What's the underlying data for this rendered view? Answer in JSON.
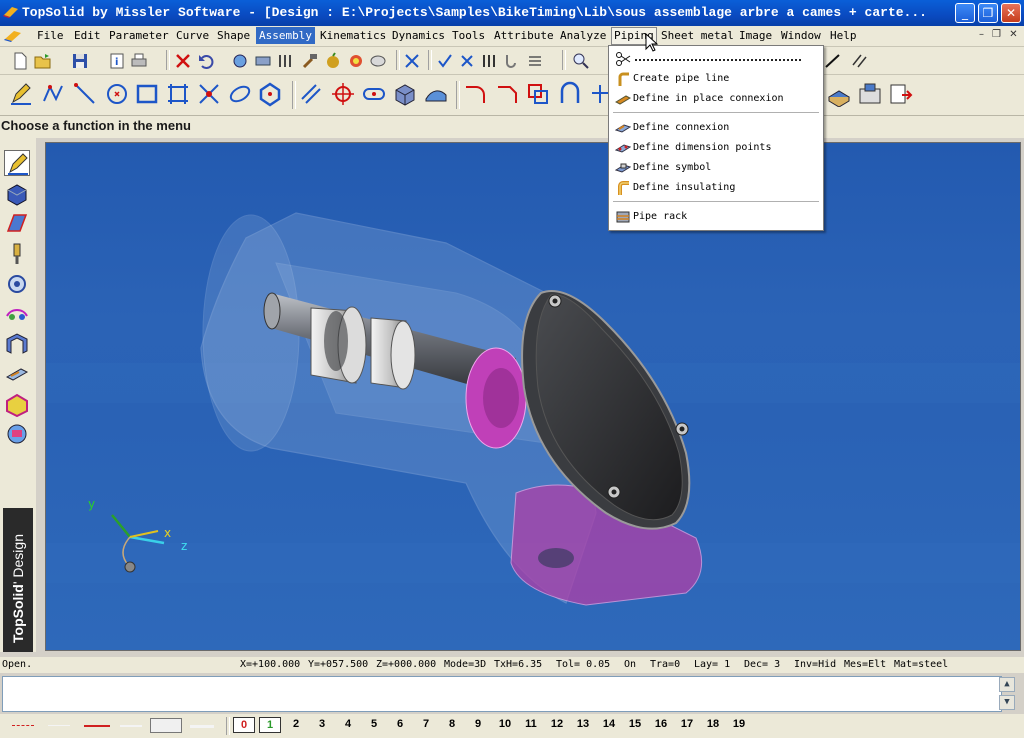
{
  "window": {
    "title": "TopSolid by Missler Software - [Design : E:\\Projects\\Samples\\BikeTiming\\Lib\\sous assemblage arbre a cames + carte...",
    "minimize": "_",
    "maximize": "❒",
    "close": "✕"
  },
  "menu": {
    "items": [
      "File",
      "Edit",
      "Parameter",
      "Curve",
      "Shape",
      "Assembly",
      "Kinematics",
      "Dynamics",
      "Tools",
      "Attribute",
      "Analyze",
      "Piping",
      "Sheet metal",
      "Image",
      "Window",
      "Help"
    ],
    "active": "Assembly",
    "open": "Piping"
  },
  "prompt": "Choose a function in the menu",
  "brand": {
    "strong": "TopSolid",
    "light": "' Design"
  },
  "piping_menu": {
    "items": [
      {
        "label": "Create pipe line",
        "icon": "pipe-line-icon"
      },
      {
        "label": "Define in place connexion",
        "icon": "in-place-connexion-icon"
      },
      {
        "label": "Define connexion",
        "icon": "connexion-icon"
      },
      {
        "label": "Define dimension points",
        "icon": "dimension-points-icon"
      },
      {
        "label": "Define symbol",
        "icon": "symbol-icon"
      },
      {
        "label": "Define insulating",
        "icon": "insulating-icon"
      },
      {
        "label": "Pipe rack",
        "icon": "pipe-rack-icon"
      }
    ]
  },
  "axes": {
    "x": "x",
    "y": "y",
    "z": "z"
  },
  "status": {
    "state": "Open.",
    "x": "X=+100.000",
    "y": "Y=+057.500",
    "z": "Z=+000.000",
    "mode": "Mode=3D",
    "txh": "TxH=6.35",
    "tol": "Tol=  0.05",
    "on": "On",
    "tra": "Tra=0",
    "lay": "Lay=  1",
    "dec": "Dec= 3",
    "inv": "Inv=Hid",
    "mes": "Mes=Elt",
    "mat": "Mat=steel"
  },
  "layers": [
    "0",
    "1",
    "2",
    "3",
    "4",
    "5",
    "6",
    "7",
    "8",
    "9",
    "10",
    "11",
    "12",
    "13",
    "14",
    "15",
    "16",
    "17",
    "18",
    "19"
  ],
  "colors": {
    "accent": "#316ac5",
    "viewport": "#2b63b6",
    "pink": "#b040a8"
  }
}
